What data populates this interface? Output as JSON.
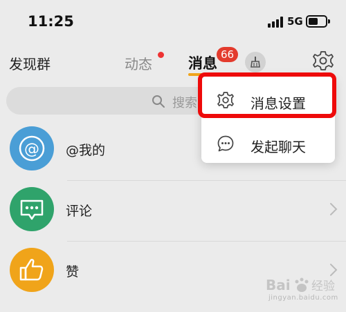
{
  "status_bar": {
    "time": "11:25",
    "network": "5G",
    "signal_bars": 4,
    "battery_level": 0.45
  },
  "nav": {
    "left_label": "发现群",
    "tabs": [
      {
        "label": "动态",
        "has_dot": true,
        "active": false
      },
      {
        "label": "消息",
        "badge": "66",
        "active": true
      }
    ],
    "icons": [
      "broom-icon",
      "gear-icon"
    ],
    "colors": {
      "badge": "#e33b2d",
      "active_underline": "#f0a41a"
    }
  },
  "search": {
    "placeholder": "搜索"
  },
  "list": [
    {
      "label": "@我的",
      "icon": "at-icon",
      "color": "#4a9ed6"
    },
    {
      "label": "评论",
      "icon": "comment-icon",
      "color": "#2fa36b"
    },
    {
      "label": "赞",
      "icon": "thumbs-up-icon",
      "color": "#f0a41a"
    }
  ],
  "menu": {
    "items": [
      {
        "label": "消息设置",
        "icon": "gear-icon",
        "highlighted": true
      },
      {
        "label": "发起聊天",
        "icon": "chat-bubble-icon",
        "highlighted": false
      }
    ],
    "highlight_color": "#ee0a0a"
  },
  "watermark": {
    "brand": "Bai 经验",
    "url": "jingyan.baidu.com"
  }
}
